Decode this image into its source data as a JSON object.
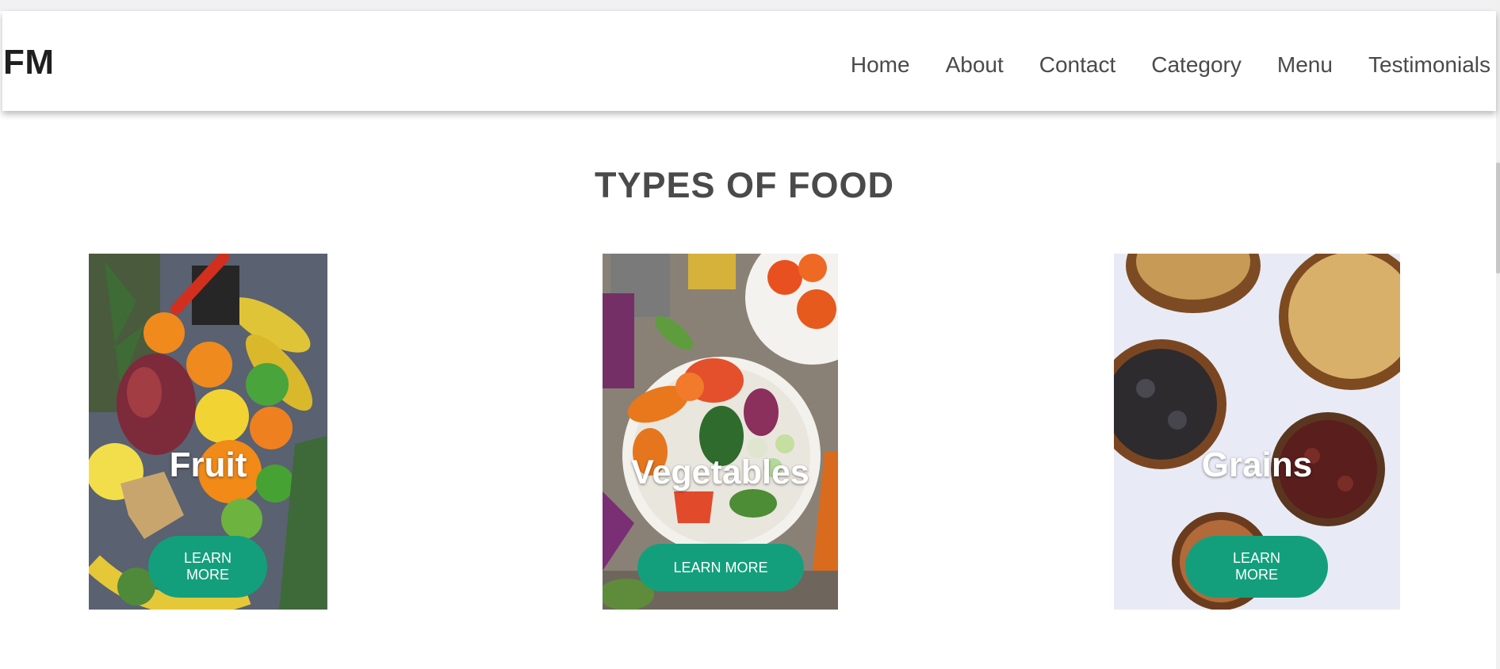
{
  "brand": {
    "logo_text": "FM"
  },
  "nav": {
    "items": [
      {
        "label": "Home"
      },
      {
        "label": "About"
      },
      {
        "label": "Contact"
      },
      {
        "label": "Category"
      },
      {
        "label": "Menu"
      },
      {
        "label": "Testimonials"
      }
    ]
  },
  "section": {
    "title": "TYPES OF FOOD"
  },
  "cards": [
    {
      "label": "Fruit",
      "button": "LEARN MORE"
    },
    {
      "label": "Vegetables",
      "button": "LEARN MORE"
    },
    {
      "label": "Grains",
      "button": "LEARN MORE"
    }
  ],
  "colors": {
    "accent": "#149f7c",
    "text": "#4a4a4a",
    "logo": "#1f1f1f"
  }
}
